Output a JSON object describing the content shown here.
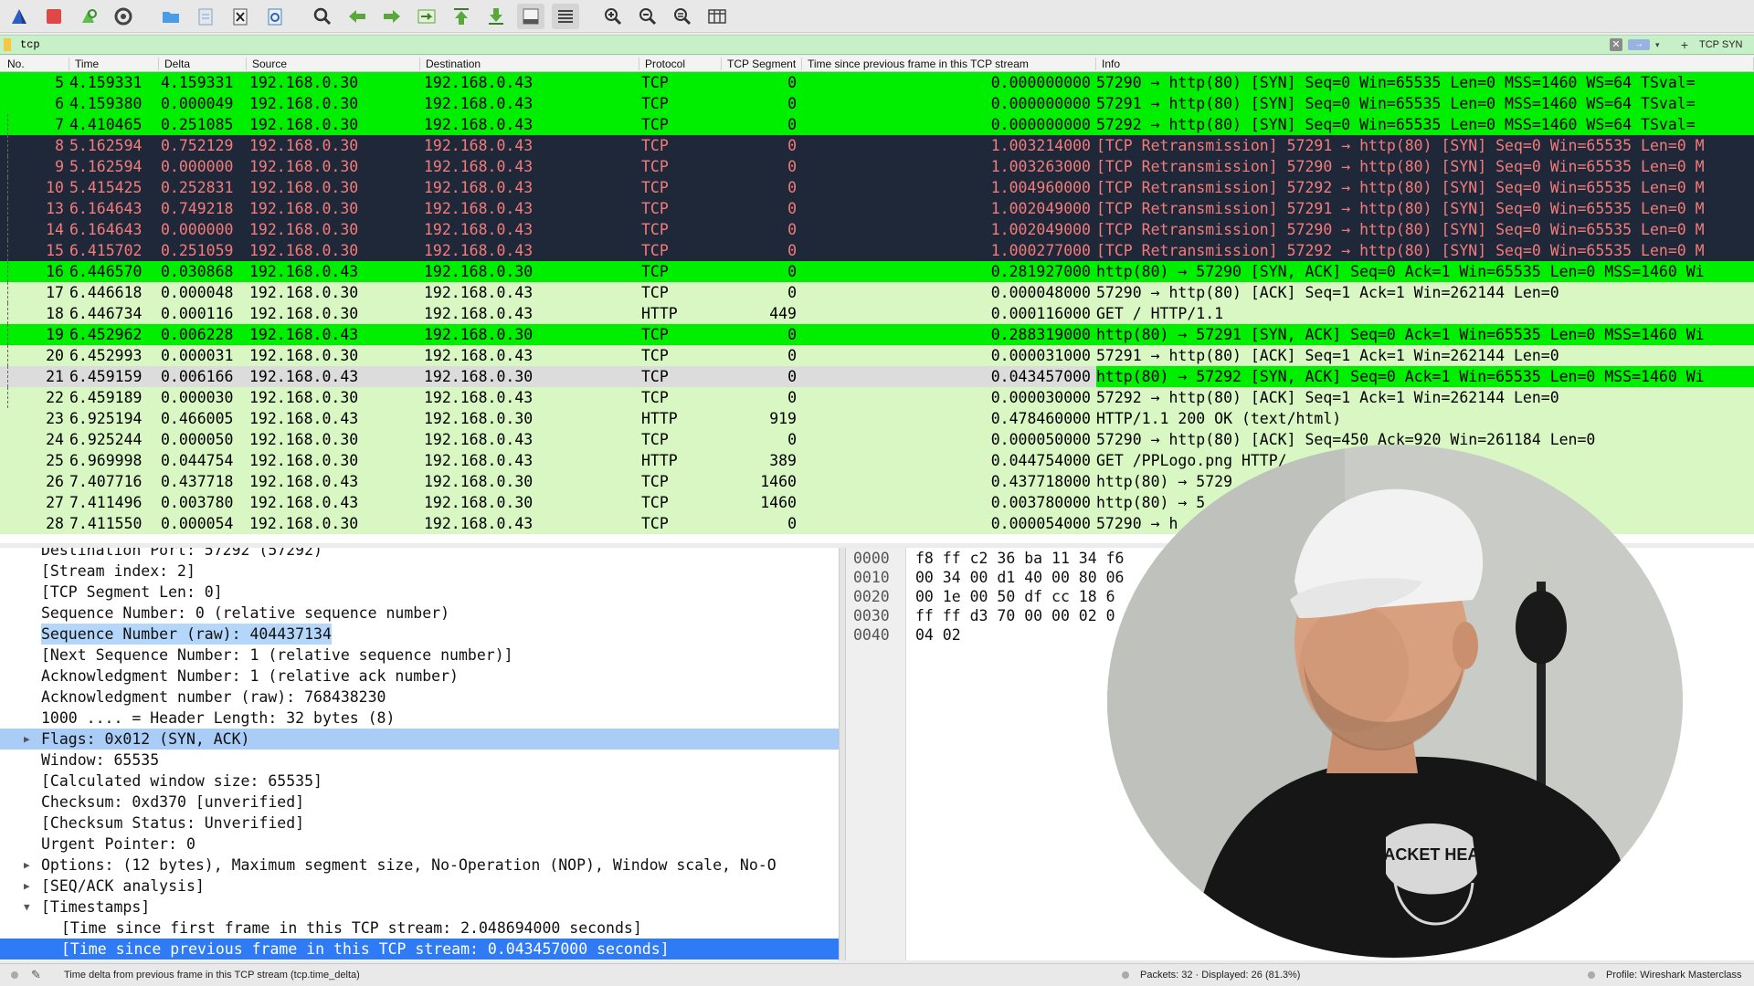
{
  "filter": {
    "value": "tcp",
    "button_label": "TCP SYN"
  },
  "packet_list": {
    "columns": [
      "No.",
      "Time",
      "Delta",
      "Source",
      "Destination",
      "Protocol",
      "TCP Segment",
      "Time since previous frame in this TCP stream",
      "Info"
    ],
    "rows": [
      {
        "no": "5",
        "time": "4.159331",
        "delta": "4.159331",
        "src": "192.168.0.30",
        "dst": "192.168.0.43",
        "proto": "TCP",
        "seg": "0",
        "tsp": "0.000000000",
        "info": "57290 → http(80) [SYN] Seq=0 Win=65535 Len=0 MSS=1460 WS=64 TSval=",
        "style": "syn"
      },
      {
        "no": "6",
        "time": "4.159380",
        "delta": "0.000049",
        "src": "192.168.0.30",
        "dst": "192.168.0.43",
        "proto": "TCP",
        "seg": "0",
        "tsp": "0.000000000",
        "info": "57291 → http(80) [SYN] Seq=0 Win=65535 Len=0 MSS=1460 WS=64 TSval=",
        "style": "syn"
      },
      {
        "no": "7",
        "time": "4.410465",
        "delta": "0.251085",
        "src": "192.168.0.30",
        "dst": "192.168.0.43",
        "proto": "TCP",
        "seg": "0",
        "tsp": "0.000000000",
        "info": "57292 → http(80) [SYN] Seq=0 Win=65535 Len=0 MSS=1460 WS=64 TSval=",
        "style": "syn"
      },
      {
        "no": "8",
        "time": "5.162594",
        "delta": "0.752129",
        "src": "192.168.0.30",
        "dst": "192.168.0.43",
        "proto": "TCP",
        "seg": "0",
        "tsp": "1.003214000",
        "info": "[TCP Retransmission] 57291 → http(80) [SYN] Seq=0 Win=65535 Len=0 M",
        "style": "bad"
      },
      {
        "no": "9",
        "time": "5.162594",
        "delta": "0.000000",
        "src": "192.168.0.30",
        "dst": "192.168.0.43",
        "proto": "TCP",
        "seg": "0",
        "tsp": "1.003263000",
        "info": "[TCP Retransmission] 57290 → http(80) [SYN] Seq=0 Win=65535 Len=0 M",
        "style": "bad"
      },
      {
        "no": "10",
        "time": "5.415425",
        "delta": "0.252831",
        "src": "192.168.0.30",
        "dst": "192.168.0.43",
        "proto": "TCP",
        "seg": "0",
        "tsp": "1.004960000",
        "info": "[TCP Retransmission] 57292 → http(80) [SYN] Seq=0 Win=65535 Len=0 M",
        "style": "bad"
      },
      {
        "no": "13",
        "time": "6.164643",
        "delta": "0.749218",
        "src": "192.168.0.30",
        "dst": "192.168.0.43",
        "proto": "TCP",
        "seg": "0",
        "tsp": "1.002049000",
        "info": "[TCP Retransmission] 57291 → http(80) [SYN] Seq=0 Win=65535 Len=0 M",
        "style": "bad"
      },
      {
        "no": "14",
        "time": "6.164643",
        "delta": "0.000000",
        "src": "192.168.0.30",
        "dst": "192.168.0.43",
        "proto": "TCP",
        "seg": "0",
        "tsp": "1.002049000",
        "info": "[TCP Retransmission] 57290 → http(80) [SYN] Seq=0 Win=65535 Len=0 M",
        "style": "bad"
      },
      {
        "no": "15",
        "time": "6.415702",
        "delta": "0.251059",
        "src": "192.168.0.30",
        "dst": "192.168.0.43",
        "proto": "TCP",
        "seg": "0",
        "tsp": "1.000277000",
        "info": "[TCP Retransmission] 57292 → http(80) [SYN] Seq=0 Win=65535 Len=0 M",
        "style": "bad"
      },
      {
        "no": "16",
        "time": "6.446570",
        "delta": "0.030868",
        "src": "192.168.0.43",
        "dst": "192.168.0.30",
        "proto": "TCP",
        "seg": "0",
        "tsp": "0.281927000",
        "info": "http(80) → 57290 [SYN, ACK] Seq=0 Ack=1 Win=65535 Len=0 MSS=1460 Wi",
        "style": "syn"
      },
      {
        "no": "17",
        "time": "6.446618",
        "delta": "0.000048",
        "src": "192.168.0.30",
        "dst": "192.168.0.43",
        "proto": "TCP",
        "seg": "0",
        "tsp": "0.000048000",
        "info": "57290 → http(80) [ACK] Seq=1 Ack=1 Win=262144 Len=0",
        "style": "tcp"
      },
      {
        "no": "18",
        "time": "6.446734",
        "delta": "0.000116",
        "src": "192.168.0.30",
        "dst": "192.168.0.43",
        "proto": "HTTP",
        "seg": "449",
        "tsp": "0.000116000",
        "info": "GET / HTTP/1.1",
        "style": "http"
      },
      {
        "no": "19",
        "time": "6.452962",
        "delta": "0.006228",
        "src": "192.168.0.43",
        "dst": "192.168.0.30",
        "proto": "TCP",
        "seg": "0",
        "tsp": "0.288319000",
        "info": "http(80) → 57291 [SYN, ACK] Seq=0 Ack=1 Win=65535 Len=0 MSS=1460 Wi",
        "style": "syn"
      },
      {
        "no": "20",
        "time": "6.452993",
        "delta": "0.000031",
        "src": "192.168.0.30",
        "dst": "192.168.0.43",
        "proto": "TCP",
        "seg": "0",
        "tsp": "0.000031000",
        "info": "57291 → http(80) [ACK] Seq=1 Ack=1 Win=262144 Len=0",
        "style": "tcp"
      },
      {
        "no": "21",
        "time": "6.459159",
        "delta": "0.006166",
        "src": "192.168.0.43",
        "dst": "192.168.0.30",
        "proto": "TCP",
        "seg": "0",
        "tsp": "0.043457000",
        "info": "http(80) → 57292 [SYN, ACK] Seq=0 Ack=1 Win=65535 Len=0 MSS=1460 Wi",
        "style": "sel"
      },
      {
        "no": "22",
        "time": "6.459189",
        "delta": "0.000030",
        "src": "192.168.0.30",
        "dst": "192.168.0.43",
        "proto": "TCP",
        "seg": "0",
        "tsp": "0.000030000",
        "info": "57292 → http(80) [ACK] Seq=1 Ack=1 Win=262144 Len=0",
        "style": "tcp"
      },
      {
        "no": "23",
        "time": "6.925194",
        "delta": "0.466005",
        "src": "192.168.0.43",
        "dst": "192.168.0.30",
        "proto": "HTTP",
        "seg": "919",
        "tsp": "0.478460000",
        "info": "HTTP/1.1 200 OK  (text/html)",
        "style": "http"
      },
      {
        "no": "24",
        "time": "6.925244",
        "delta": "0.000050",
        "src": "192.168.0.30",
        "dst": "192.168.0.43",
        "proto": "TCP",
        "seg": "0",
        "tsp": "0.000050000",
        "info": "57290 → http(80) [ACK] Seq=450 Ack=920 Win=261184 Len=0",
        "style": "tcp"
      },
      {
        "no": "25",
        "time": "6.969998",
        "delta": "0.044754",
        "src": "192.168.0.30",
        "dst": "192.168.0.43",
        "proto": "HTTP",
        "seg": "389",
        "tsp": "0.044754000",
        "info": "GET /PPLogo.png HTTP/",
        "style": "http"
      },
      {
        "no": "26",
        "time": "7.407716",
        "delta": "0.437718",
        "src": "192.168.0.43",
        "dst": "192.168.0.30",
        "proto": "TCP",
        "seg": "1460",
        "tsp": "0.437718000",
        "info": "http(80) → 5729",
        "style": "tcp"
      },
      {
        "no": "27",
        "time": "7.411496",
        "delta": "0.003780",
        "src": "192.168.0.43",
        "dst": "192.168.0.30",
        "proto": "TCP",
        "seg": "1460",
        "tsp": "0.003780000",
        "info": "http(80) → 5",
        "style": "tcp"
      },
      {
        "no": "28",
        "time": "7.411550",
        "delta": "0.000054",
        "src": "192.168.0.30",
        "dst": "192.168.0.43",
        "proto": "TCP",
        "seg": "0",
        "tsp": "0.000054000",
        "info": "57290 → h",
        "style": "tcp"
      }
    ]
  },
  "details": {
    "lines": [
      {
        "text": "Destination Port: 57292 (57292)",
        "indent": 1,
        "state": "",
        "tri": ""
      },
      {
        "text": "[Stream index: 2]",
        "indent": 1,
        "state": "",
        "tri": ""
      },
      {
        "text": "[TCP Segment Len: 0]",
        "indent": 1,
        "state": "",
        "tri": ""
      },
      {
        "text": "Sequence Number: 0    (relative sequence number)",
        "indent": 1,
        "state": "",
        "tri": ""
      },
      {
        "text": "Sequence Number (raw): 404437134",
        "indent": 1,
        "state": "light",
        "tri": ""
      },
      {
        "text": "[Next Sequence Number: 1    (relative sequence number)]",
        "indent": 1,
        "state": "",
        "tri": ""
      },
      {
        "text": "Acknowledgment Number: 1    (relative ack number)",
        "indent": 1,
        "state": "",
        "tri": ""
      },
      {
        "text": "Acknowledgment number (raw): 768438230",
        "indent": 1,
        "state": "",
        "tri": ""
      },
      {
        "text": "1000 .... = Header Length: 32 bytes (8)",
        "indent": 1,
        "state": "",
        "tri": ""
      },
      {
        "text": "Flags: 0x012 (SYN, ACK)",
        "indent": 1,
        "state": "band",
        "tri": "▶"
      },
      {
        "text": "Window: 65535",
        "indent": 1,
        "state": "",
        "tri": ""
      },
      {
        "text": "[Calculated window size: 65535]",
        "indent": 1,
        "state": "",
        "tri": ""
      },
      {
        "text": "Checksum: 0xd370 [unverified]",
        "indent": 1,
        "state": "",
        "tri": ""
      },
      {
        "text": "[Checksum Status: Unverified]",
        "indent": 1,
        "state": "",
        "tri": ""
      },
      {
        "text": "Urgent Pointer: 0",
        "indent": 1,
        "state": "",
        "tri": ""
      },
      {
        "text": "Options: (12 bytes), Maximum segment size, No-Operation (NOP), Window scale, No-O",
        "indent": 1,
        "state": "",
        "tri": "▶"
      },
      {
        "text": "[SEQ/ACK analysis]",
        "indent": 1,
        "state": "",
        "tri": "▶"
      },
      {
        "text": "[Timestamps]",
        "indent": 1,
        "state": "",
        "tri": "▼"
      },
      {
        "text": "[Time since first frame in this TCP stream: 2.048694000 seconds]",
        "indent": 2,
        "state": "",
        "tri": ""
      },
      {
        "text": "[Time since previous frame in this TCP stream: 0.043457000 seconds]",
        "indent": 2,
        "state": "strong",
        "tri": ""
      }
    ]
  },
  "bytes": {
    "offsets": [
      "0000",
      "0010",
      "0020",
      "0030",
      "0040"
    ],
    "hex": [
      "f8 ff c2 36 ba 11 34 f6",
      "00 34 00 d1 40 00 80 06",
      "00 1e 00 50 df cc 18 6",
      "ff ff d3 70 00 00 02 0",
      "04 02"
    ]
  },
  "webcam": {
    "shirt_text": "PACKET HEAD"
  },
  "status": {
    "field_help": "Time delta from previous frame in this TCP stream (tcp.time_delta)",
    "packets": "Packets: 32 · Displayed: 26 (81.3%)",
    "profile": "Profile: Wireshark Masterclass"
  },
  "colors": {
    "syn_green": "#00ee00",
    "tcp_light_green": "#d8f7c2",
    "bad_bg": "#1e2838",
    "bad_text": "#f27b7b",
    "selection_blue": "#2f7af5"
  }
}
